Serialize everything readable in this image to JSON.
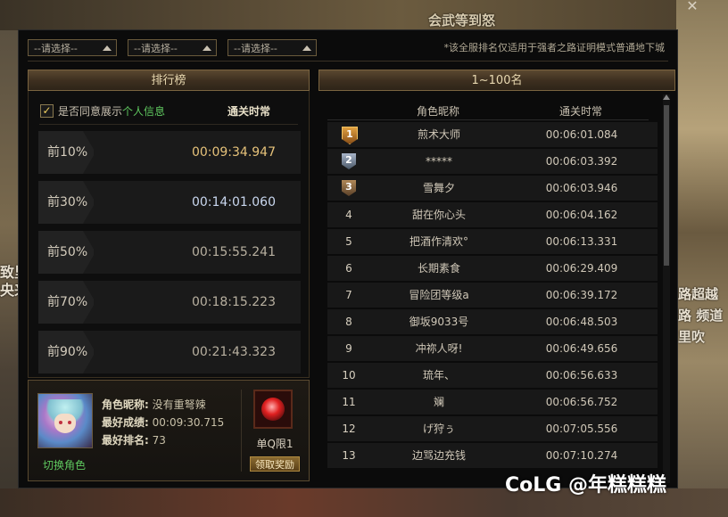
{
  "window": {
    "close_glyph": "✕"
  },
  "background": {
    "left_text": "致里\n央来",
    "right_text": "路超越\n路 频道\n里吹",
    "top_text": "会武等到怒"
  },
  "filters": {
    "selects": [
      {
        "value": "--请选择--"
      },
      {
        "value": "--请选择--"
      },
      {
        "value": "--请选择--"
      }
    ],
    "notice": "*该全服排名仅适用于强者之路证明模式普通地下城"
  },
  "left_panel": {
    "title": "排行榜",
    "agree_checked": true,
    "agree_prefix": "是否同意展示",
    "agree_link": "个人信息",
    "clear_time_header": "通关时常",
    "percentiles": [
      {
        "label": "前10%",
        "time": "00:09:34.947",
        "color": "#e6c27a"
      },
      {
        "label": "前30%",
        "time": "00:14:01.060",
        "color": "#c9d7ef"
      },
      {
        "label": "前50%",
        "time": "00:15:55.241",
        "color": "#b8b0a0"
      },
      {
        "label": "前70%",
        "time": "00:18:15.223",
        "color": "#b8b0a0"
      },
      {
        "label": "前90%",
        "time": "00:21:43.323",
        "color": "#b8b0a0"
      }
    ]
  },
  "character": {
    "name_key": "角色昵称:",
    "name_value": "没有重弩辣",
    "best_score_key": "最好成绩:",
    "best_score_value": "00:09:30.715",
    "best_rank_key": "最好排名:",
    "best_rank_value": "73",
    "switch_label": "切换角色",
    "reward_label": "单Q限1",
    "claim_label": "领取奖励"
  },
  "right_panel": {
    "title": "1~100名",
    "col_name": "角色昵称",
    "col_time": "通关时常",
    "rows": [
      {
        "rank": "1",
        "medal": "gold",
        "name": "煎术大师",
        "time": "00:06:01.084"
      },
      {
        "rank": "2",
        "medal": "silver",
        "name": "*****",
        "time": "00:06:03.392"
      },
      {
        "rank": "3",
        "medal": "bronze",
        "name": "雪舞夕",
        "time": "00:06:03.946"
      },
      {
        "rank": "4",
        "medal": "",
        "name": "甜在你心头",
        "time": "00:06:04.162"
      },
      {
        "rank": "5",
        "medal": "",
        "name": "把酒作清欢°",
        "time": "00:06:13.331"
      },
      {
        "rank": "6",
        "medal": "",
        "name": "长期素食",
        "time": "00:06:29.409"
      },
      {
        "rank": "7",
        "medal": "",
        "name": "冒险团等级a",
        "time": "00:06:39.172"
      },
      {
        "rank": "8",
        "medal": "",
        "name": "御坂9033号",
        "time": "00:06:48.503"
      },
      {
        "rank": "9",
        "medal": "",
        "name": "冲祢人呀!",
        "time": "00:06:49.656"
      },
      {
        "rank": "10",
        "medal": "",
        "name": "琉年、",
        "time": "00:06:56.633"
      },
      {
        "rank": "11",
        "medal": "",
        "name": "斓",
        "time": "00:06:56.752"
      },
      {
        "rank": "12",
        "medal": "",
        "name": "げ狩ぅ",
        "time": "00:07:05.556"
      },
      {
        "rank": "13",
        "medal": "",
        "name": "边骂边充钱",
        "time": "00:07:10.274"
      }
    ]
  },
  "watermark": "CoLG @年糕糕糕"
}
